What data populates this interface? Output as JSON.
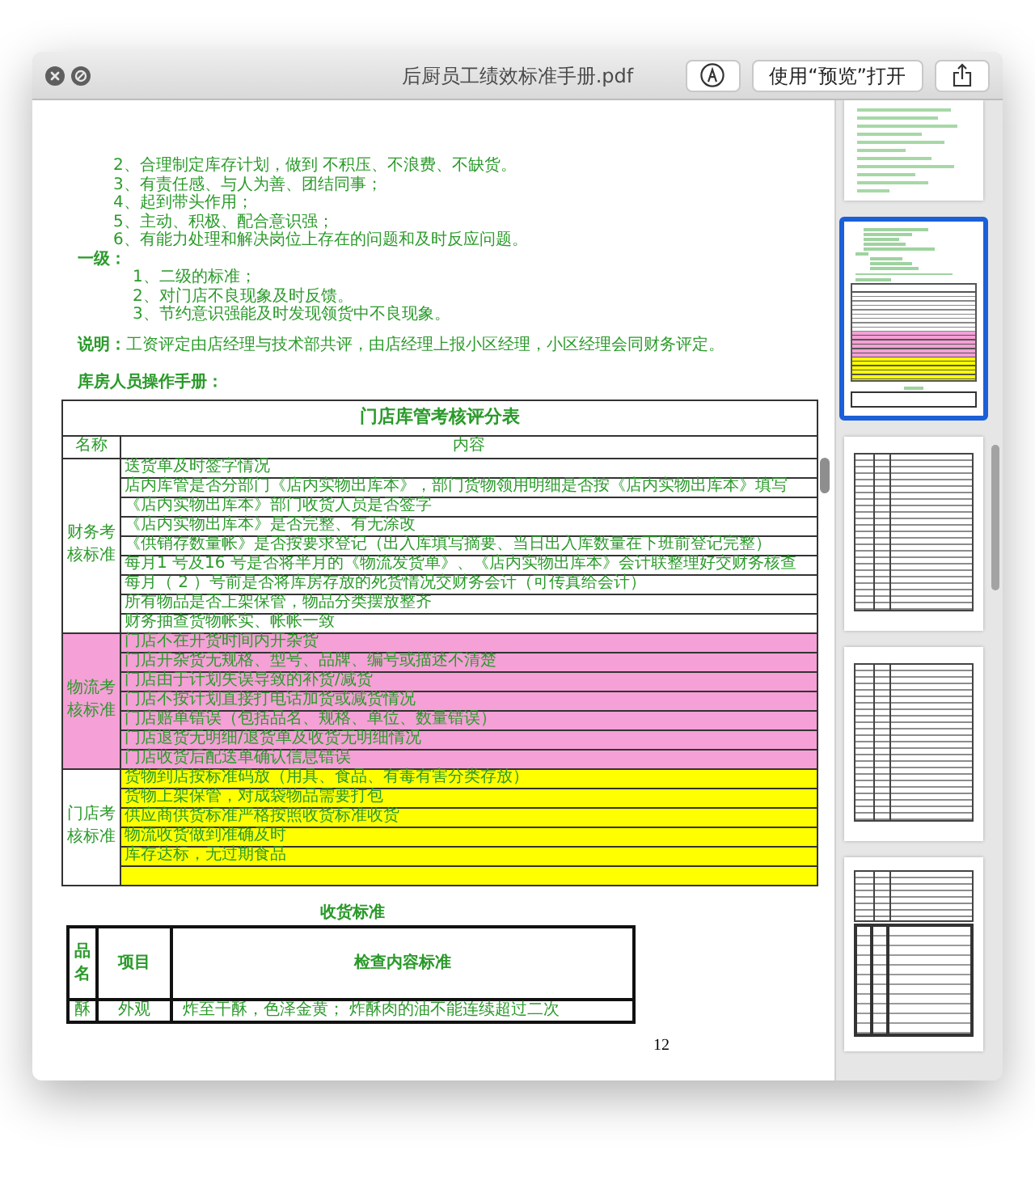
{
  "window": {
    "title": "后厨员工绩效标准手册.pdf"
  },
  "toolbar": {
    "open_button": "使用“预览”打开"
  },
  "page": {
    "items": [
      "2、合理制定库存计划，做到 不积压、不浪费、不缺货。",
      "3、有责任感、与人为善、团结同事；",
      "4、起到带头作用；",
      "5、主动、积极、配合意识强；",
      "6、有能力处理和解决岗位上存在的问题和及时反应问题。"
    ],
    "level_heading": "一级：",
    "level_items": [
      "1、二级的标准；",
      "2、对门店不良现象及时反馈。",
      "3、节约意识强能及时发现领货中不良现象。"
    ],
    "note": "**说明：**工资评定由店经理与技术部共评，由店经理上报小区经理，小区经理会同财务评定。",
    "section_heading": "库房人员操作手册：",
    "score_table": {
      "title": "门店库管考核评分表",
      "columns": [
        "名称",
        "内容"
      ],
      "groups": [
        {
          "name": "财务考核标准",
          "color": "#ffffff",
          "name_filled": false,
          "blank_row": false,
          "rows": [
            "送货单及时签字情况",
            "店内库管是否分部门《店内实物出库本》，部门货物领用明细是否按《店内实物出库本》填写",
            "《店内实物出库本》部门收货人员是否签字",
            "《店内实物出库本》是否完整、有无涂改",
            "《供销存数量帐》是否按要求登记（出入库填写摘要、当日出入库数量在下班前登记完整）",
            "每月1 号及16 号是否将半月的《物流发货单》、《店内实物出库本》会计联整理好交财务核查",
            "每月（ 2 ）号前是否将库房存放的死货情况交财务会计（可传真给会计）",
            "所有物品是否上架保管，物品分类摆放整齐",
            "财务抽查货物帐实、帐帐一致"
          ]
        },
        {
          "name": "物流考核标准",
          "color": "#f5a0d6",
          "name_filled": true,
          "blank_row": false,
          "rows": [
            "门店不在开货时间内开杂货",
            "门店开杂货无规格、型号、品牌、编号或描述不清楚",
            "门店由于计划失误导致的补货/减货",
            "门店不按计划直接打电话加货或减货情况",
            "门店赔单错误（包括品名、规格、单位、数量错误）",
            "门店退货无明细/退货单及收货无明细情况",
            "门店收货后配送单确认信息错误"
          ]
        },
        {
          "name": "门店考核标准",
          "color": "#ffff00",
          "name_filled": false,
          "blank_row": true,
          "rows": [
            "货物到店按标准码放（用具、食品、有毒有害分类存放）",
            "货物上架保管，对成袋物品需要打包",
            "供应商供货标准严格按照收货标准收货",
            "物流收货做到准确及时",
            "库存达标，无过期食品"
          ]
        }
      ]
    },
    "receiving_caption": "收货标准",
    "receiving_table": {
      "columns": [
        "品名",
        "项目",
        "检查内容标准"
      ],
      "rows": [
        [
          "酥",
          "外观",
          "炸至干酥，色泽金黄； 炸酥肉的油不能连续超过二次"
        ]
      ]
    },
    "page_number": "12"
  },
  "thumbnails": [
    {
      "kind": "text",
      "selected": false
    },
    {
      "kind": "colored",
      "selected": true
    },
    {
      "kind": "table",
      "selected": false
    },
    {
      "kind": "table",
      "selected": false
    },
    {
      "kind": "mixed",
      "selected": false
    }
  ]
}
